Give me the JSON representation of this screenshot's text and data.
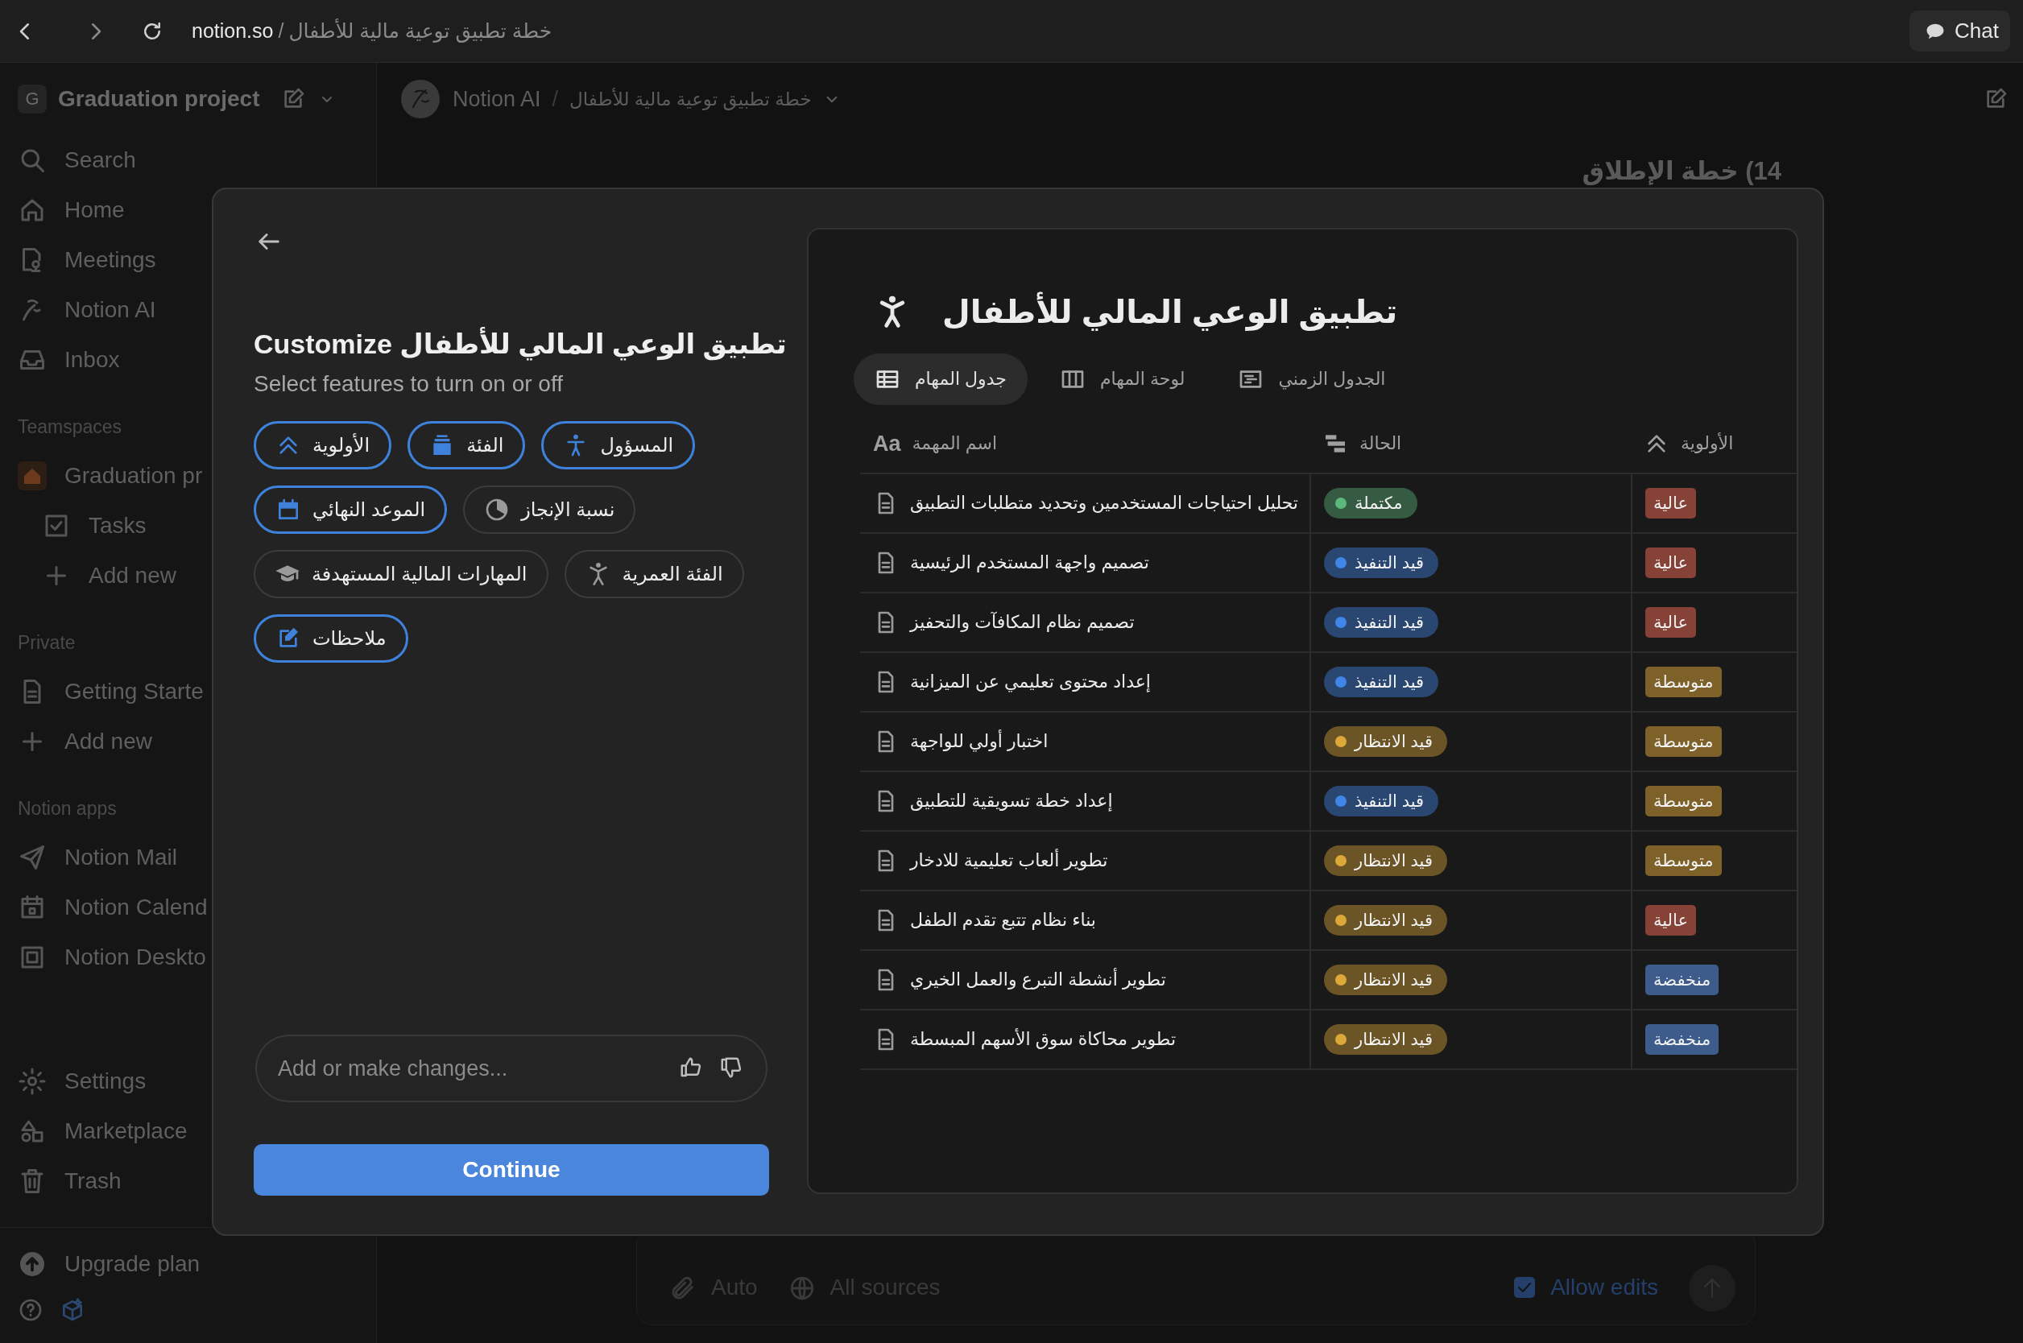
{
  "browser": {
    "host": "notion.so",
    "separator": "/",
    "path": "خطة تطبيق توعية مالية للأطفال",
    "chat_button": "Chat"
  },
  "sidebar": {
    "workspace": {
      "initial": "G",
      "name": "Graduation project"
    },
    "top_items": [
      {
        "label": "Search",
        "kind": "search"
      },
      {
        "label": "Home",
        "kind": "home"
      },
      {
        "label": "Meetings",
        "kind": "meetings"
      },
      {
        "label": "Notion AI",
        "kind": "ai"
      },
      {
        "label": "Inbox",
        "kind": "inbox"
      }
    ],
    "sections": [
      {
        "heading": "Teamspaces",
        "items": [
          {
            "label": "Graduation pr",
            "kind": "teamspace",
            "children": [
              {
                "label": "Tasks",
                "kind": "database"
              },
              {
                "label": "Add new",
                "kind": "add"
              }
            ]
          }
        ]
      },
      {
        "heading": "Private",
        "items": [
          {
            "label": "Getting Starte",
            "kind": "page"
          },
          {
            "label": "Add new",
            "kind": "add"
          }
        ]
      },
      {
        "heading": "Notion apps",
        "items": [
          {
            "label": "Notion Mail",
            "kind": "mail"
          },
          {
            "label": "Notion Calend",
            "kind": "calendar"
          },
          {
            "label": "Notion Deskto",
            "kind": "desktop"
          }
        ]
      }
    ],
    "bottom_items": [
      {
        "label": "Settings",
        "kind": "settings"
      },
      {
        "label": "Marketplace",
        "kind": "marketplace"
      },
      {
        "label": "Trash",
        "kind": "trash"
      }
    ],
    "upgrade": "Upgrade plan"
  },
  "header": {
    "ai_label": "Notion AI",
    "separator": "/",
    "breadcrumb": "خطة تطبيق توعية مالية للأطفال"
  },
  "page_heading": "14) خطة الإطلاق",
  "composer": {
    "mode": "Auto",
    "sources": "All sources",
    "allow_edits": {
      "label": "Allow edits",
      "checked": true
    }
  },
  "modal": {
    "title": "Customize تطبيق الوعي المالي للأطفال",
    "subtitle": "Select features to turn on or off",
    "features": [
      {
        "label": "المسؤول",
        "kind": "owner",
        "selected": true
      },
      {
        "label": "الفئة",
        "kind": "category",
        "selected": true
      },
      {
        "label": "الأولوية",
        "kind": "priority",
        "selected": true
      },
      {
        "label": "نسبة الإنجاز",
        "kind": "progress",
        "selected": false
      },
      {
        "label": "الموعد النهائي",
        "kind": "deadline",
        "selected": true
      },
      {
        "label": "الفئة العمرية",
        "kind": "age",
        "selected": false
      },
      {
        "label": "المهارات المالية المستهدفة",
        "kind": "skills",
        "selected": false
      },
      {
        "label": "ملاحظات",
        "kind": "notes",
        "selected": true
      }
    ],
    "input_placeholder": "Add or make changes...",
    "continue_button": "Continue"
  },
  "preview": {
    "title": "تطبيق الوعي المالي للأطفال",
    "tabs": [
      {
        "label": "الجدول الزمني",
        "kind": "timeline",
        "selected": false
      },
      {
        "label": "لوحة المهام",
        "kind": "board",
        "selected": false
      },
      {
        "label": "جدول المهام",
        "kind": "table",
        "selected": true
      }
    ],
    "columns": [
      {
        "label": "الأولوية",
        "kind": "priority"
      },
      {
        "label": "الحالة",
        "kind": "status"
      },
      {
        "label": "اسم المهمة",
        "kind": "title",
        "glyph": "Aa"
      }
    ],
    "rows": [
      {
        "name": "تحليل احتياجات المستخدمين وتحديد متطلبات التطبيق",
        "status": {
          "label": "مكتملة",
          "color": "#5cb87a"
        },
        "priority": {
          "label": "عالية",
          "color": "#874238"
        }
      },
      {
        "name": "تصميم واجهة المستخدم الرئيسية",
        "status": {
          "label": "قيد التنفيذ",
          "color": "#3f86e8"
        },
        "priority": {
          "label": "عالية",
          "color": "#874238"
        }
      },
      {
        "name": "تصميم نظام المكافآت والتحفيز",
        "status": {
          "label": "قيد التنفيذ",
          "color": "#3f86e8"
        },
        "priority": {
          "label": "عالية",
          "color": "#874238"
        }
      },
      {
        "name": "إعداد محتوى تعليمي عن الميزانية",
        "status": {
          "label": "قيد التنفيذ",
          "color": "#3f86e8"
        },
        "priority": {
          "label": "متوسطة",
          "color": "#7d6128"
        }
      },
      {
        "name": "اختبار أولي للواجهة",
        "status": {
          "label": "قيد الانتظار",
          "color": "#dca838"
        },
        "priority": {
          "label": "متوسطة",
          "color": "#7d6128"
        }
      },
      {
        "name": "إعداد خطة تسويقية للتطبيق",
        "status": {
          "label": "قيد التنفيذ",
          "color": "#3f86e8"
        },
        "priority": {
          "label": "متوسطة",
          "color": "#7d6128"
        }
      },
      {
        "name": "تطوير ألعاب تعليمية للادخار",
        "status": {
          "label": "قيد الانتظار",
          "color": "#dca838"
        },
        "priority": {
          "label": "متوسطة",
          "color": "#7d6128"
        }
      },
      {
        "name": "بناء نظام تتبع تقدم الطفل",
        "status": {
          "label": "قيد الانتظار",
          "color": "#dca838"
        },
        "priority": {
          "label": "عالية",
          "color": "#874238"
        }
      },
      {
        "name": "تطوير أنشطة التبرع والعمل الخيري",
        "status": {
          "label": "قيد الانتظار",
          "color": "#dca838"
        },
        "priority": {
          "label": "منخفضة",
          "color": "#3d5c8c"
        }
      },
      {
        "name": "تطوير محاكاة سوق الأسهم المبسطة",
        "status": {
          "label": "قيد الانتظار",
          "color": "#dca838"
        },
        "priority": {
          "label": "منخفضة",
          "color": "#3d5c8c"
        }
      }
    ]
  }
}
